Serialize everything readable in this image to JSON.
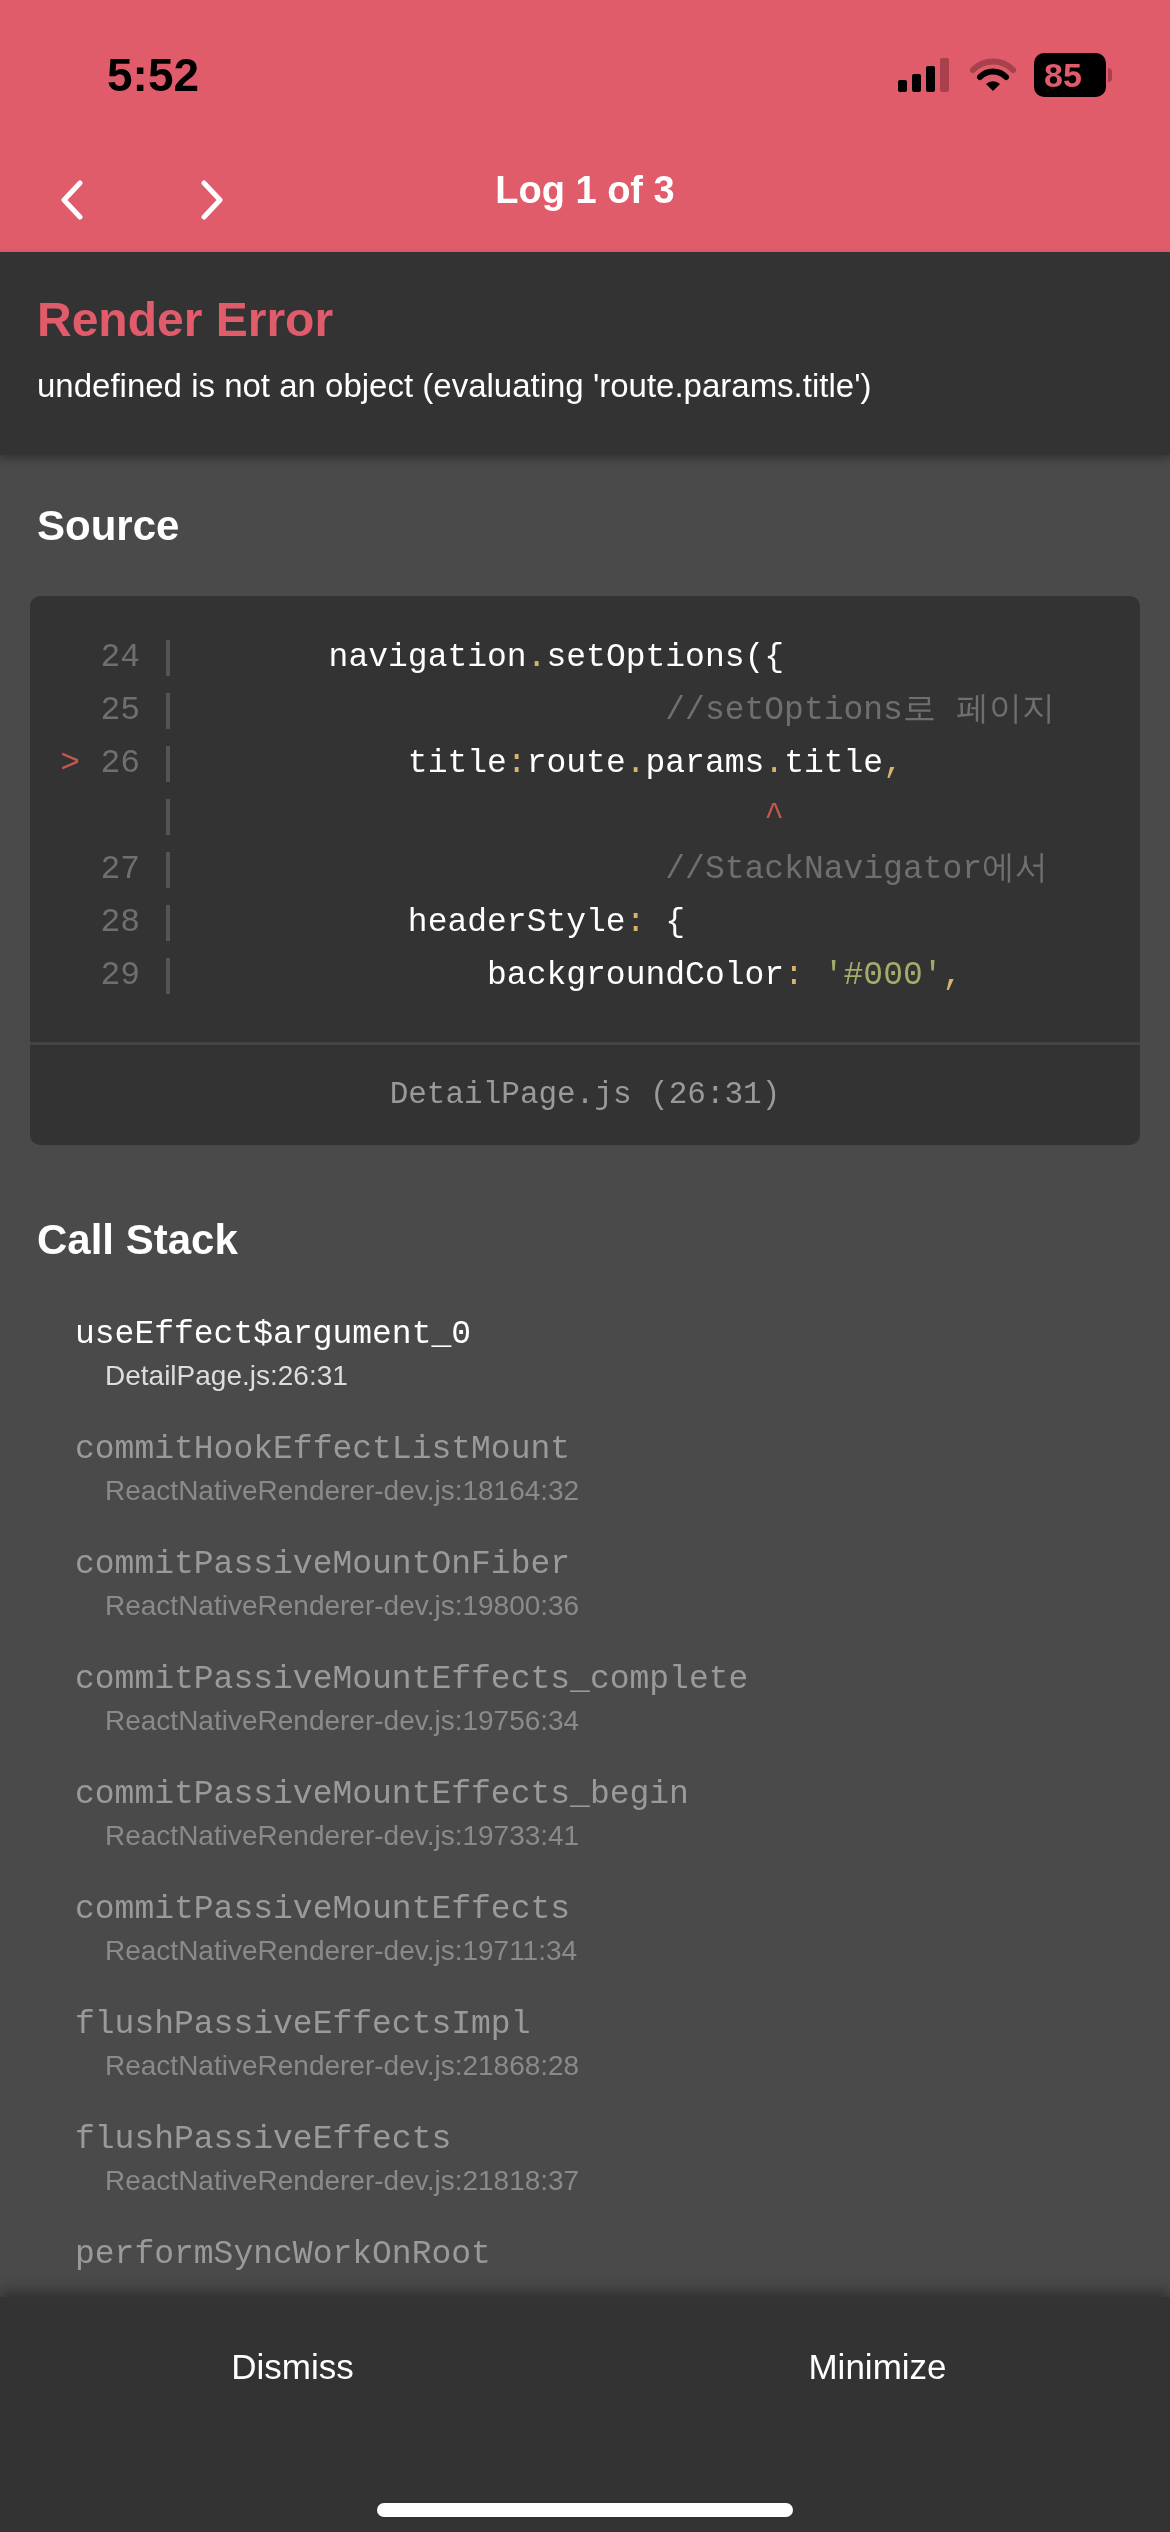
{
  "status_bar": {
    "time": "5:52",
    "battery": "85"
  },
  "header": {
    "title": "Log 1 of 3"
  },
  "error": {
    "title": "Render Error",
    "message": "undefined is not an object (evaluating 'route.params.title')"
  },
  "source": {
    "title": "Source",
    "file": "DetailPage.js (26:31)",
    "lines": [
      {
        "number": "24",
        "segments": [
          {
            "kind": "code",
            "text": "       navigation"
          },
          {
            "kind": "punct",
            "text": "."
          },
          {
            "kind": "code",
            "text": "setOptions({"
          }
        ]
      },
      {
        "number": "25",
        "segments": [
          {
            "kind": "comment",
            "text": "                        //setOptions로 페이지"
          }
        ]
      },
      {
        "number": "26",
        "marker": ">",
        "segments": [
          {
            "kind": "code",
            "text": "           title"
          },
          {
            "kind": "punct",
            "text": ":"
          },
          {
            "kind": "code",
            "text": "route"
          },
          {
            "kind": "punct",
            "text": "."
          },
          {
            "kind": "code",
            "text": "params"
          },
          {
            "kind": "punct",
            "text": "."
          },
          {
            "kind": "code",
            "text": "title"
          },
          {
            "kind": "punct",
            "text": ","
          }
        ]
      },
      {
        "segments": [
          {
            "kind": "caret",
            "text": "                             ^"
          }
        ]
      },
      {
        "number": "27",
        "segments": [
          {
            "kind": "comment",
            "text": "                        //StackNavigator에서"
          }
        ]
      },
      {
        "number": "28",
        "segments": [
          {
            "kind": "code",
            "text": "           headerStyle"
          },
          {
            "kind": "punct",
            "text": ":"
          },
          {
            "kind": "code",
            "text": " {"
          }
        ]
      },
      {
        "number": "29",
        "segments": [
          {
            "kind": "code",
            "text": "               backgroundColor"
          },
          {
            "kind": "punct",
            "text": ":"
          },
          {
            "kind": "string",
            "text": " '#000'"
          },
          {
            "kind": "punct",
            "text": ","
          }
        ]
      }
    ]
  },
  "call_stack": {
    "title": "Call Stack",
    "frames": [
      {
        "name": "useEffect$argument_0",
        "location": "DetailPage.js:26:31",
        "dimmed": false
      },
      {
        "name": "commitHookEffectListMount",
        "location": "ReactNativeRenderer-dev.js:18164:32",
        "dimmed": true
      },
      {
        "name": "commitPassiveMountOnFiber",
        "location": "ReactNativeRenderer-dev.js:19800:36",
        "dimmed": true
      },
      {
        "name": "commitPassiveMountEffects_complete",
        "location": "ReactNativeRenderer-dev.js:19756:34",
        "dimmed": true
      },
      {
        "name": "commitPassiveMountEffects_begin",
        "location": "ReactNativeRenderer-dev.js:19733:41",
        "dimmed": true
      },
      {
        "name": "commitPassiveMountEffects",
        "location": "ReactNativeRenderer-dev.js:19711:34",
        "dimmed": true
      },
      {
        "name": "flushPassiveEffectsImpl",
        "location": "ReactNativeRenderer-dev.js:21868:28",
        "dimmed": true
      },
      {
        "name": "flushPassiveEffects",
        "location": "ReactNativeRenderer-dev.js:21818:37",
        "dimmed": true
      },
      {
        "name": "performSyncWorkOnRoot",
        "dimmed": true
      }
    ]
  },
  "buttons": [
    "Dismiss",
    "Minimize"
  ]
}
